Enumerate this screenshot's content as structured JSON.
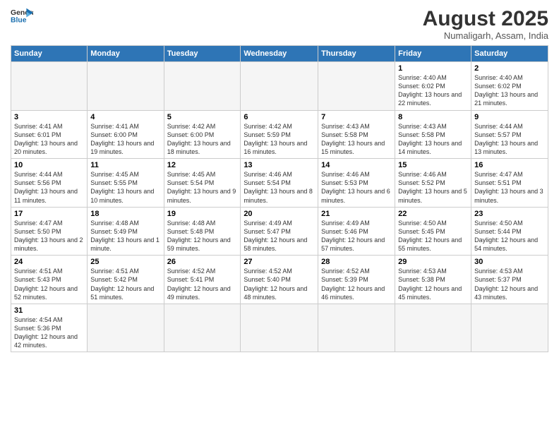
{
  "logo": {
    "text_general": "General",
    "text_blue": "Blue"
  },
  "header": {
    "month_year": "August 2025",
    "location": "Numaligarh, Assam, India"
  },
  "weekdays": [
    "Sunday",
    "Monday",
    "Tuesday",
    "Wednesday",
    "Thursday",
    "Friday",
    "Saturday"
  ],
  "weeks": [
    [
      {
        "day": "",
        "info": "",
        "empty": true
      },
      {
        "day": "",
        "info": "",
        "empty": true
      },
      {
        "day": "",
        "info": "",
        "empty": true
      },
      {
        "day": "",
        "info": "",
        "empty": true
      },
      {
        "day": "",
        "info": "",
        "empty": true
      },
      {
        "day": "1",
        "info": "Sunrise: 4:40 AM\nSunset: 6:02 PM\nDaylight: 13 hours\nand 22 minutes."
      },
      {
        "day": "2",
        "info": "Sunrise: 4:40 AM\nSunset: 6:02 PM\nDaylight: 13 hours\nand 21 minutes."
      }
    ],
    [
      {
        "day": "3",
        "info": "Sunrise: 4:41 AM\nSunset: 6:01 PM\nDaylight: 13 hours\nand 20 minutes."
      },
      {
        "day": "4",
        "info": "Sunrise: 4:41 AM\nSunset: 6:00 PM\nDaylight: 13 hours\nand 19 minutes."
      },
      {
        "day": "5",
        "info": "Sunrise: 4:42 AM\nSunset: 6:00 PM\nDaylight: 13 hours\nand 18 minutes."
      },
      {
        "day": "6",
        "info": "Sunrise: 4:42 AM\nSunset: 5:59 PM\nDaylight: 13 hours\nand 16 minutes."
      },
      {
        "day": "7",
        "info": "Sunrise: 4:43 AM\nSunset: 5:58 PM\nDaylight: 13 hours\nand 15 minutes."
      },
      {
        "day": "8",
        "info": "Sunrise: 4:43 AM\nSunset: 5:58 PM\nDaylight: 13 hours\nand 14 minutes."
      },
      {
        "day": "9",
        "info": "Sunrise: 4:44 AM\nSunset: 5:57 PM\nDaylight: 13 hours\nand 13 minutes."
      }
    ],
    [
      {
        "day": "10",
        "info": "Sunrise: 4:44 AM\nSunset: 5:56 PM\nDaylight: 13 hours\nand 11 minutes."
      },
      {
        "day": "11",
        "info": "Sunrise: 4:45 AM\nSunset: 5:55 PM\nDaylight: 13 hours\nand 10 minutes."
      },
      {
        "day": "12",
        "info": "Sunrise: 4:45 AM\nSunset: 5:54 PM\nDaylight: 13 hours\nand 9 minutes."
      },
      {
        "day": "13",
        "info": "Sunrise: 4:46 AM\nSunset: 5:54 PM\nDaylight: 13 hours\nand 8 minutes."
      },
      {
        "day": "14",
        "info": "Sunrise: 4:46 AM\nSunset: 5:53 PM\nDaylight: 13 hours\nand 6 minutes."
      },
      {
        "day": "15",
        "info": "Sunrise: 4:46 AM\nSunset: 5:52 PM\nDaylight: 13 hours\nand 5 minutes."
      },
      {
        "day": "16",
        "info": "Sunrise: 4:47 AM\nSunset: 5:51 PM\nDaylight: 13 hours\nand 3 minutes."
      }
    ],
    [
      {
        "day": "17",
        "info": "Sunrise: 4:47 AM\nSunset: 5:50 PM\nDaylight: 13 hours\nand 2 minutes."
      },
      {
        "day": "18",
        "info": "Sunrise: 4:48 AM\nSunset: 5:49 PM\nDaylight: 13 hours\nand 1 minute."
      },
      {
        "day": "19",
        "info": "Sunrise: 4:48 AM\nSunset: 5:48 PM\nDaylight: 12 hours\nand 59 minutes."
      },
      {
        "day": "20",
        "info": "Sunrise: 4:49 AM\nSunset: 5:47 PM\nDaylight: 12 hours\nand 58 minutes."
      },
      {
        "day": "21",
        "info": "Sunrise: 4:49 AM\nSunset: 5:46 PM\nDaylight: 12 hours\nand 57 minutes."
      },
      {
        "day": "22",
        "info": "Sunrise: 4:50 AM\nSunset: 5:45 PM\nDaylight: 12 hours\nand 55 minutes."
      },
      {
        "day": "23",
        "info": "Sunrise: 4:50 AM\nSunset: 5:44 PM\nDaylight: 12 hours\nand 54 minutes."
      }
    ],
    [
      {
        "day": "24",
        "info": "Sunrise: 4:51 AM\nSunset: 5:43 PM\nDaylight: 12 hours\nand 52 minutes."
      },
      {
        "day": "25",
        "info": "Sunrise: 4:51 AM\nSunset: 5:42 PM\nDaylight: 12 hours\nand 51 minutes."
      },
      {
        "day": "26",
        "info": "Sunrise: 4:52 AM\nSunset: 5:41 PM\nDaylight: 12 hours\nand 49 minutes."
      },
      {
        "day": "27",
        "info": "Sunrise: 4:52 AM\nSunset: 5:40 PM\nDaylight: 12 hours\nand 48 minutes."
      },
      {
        "day": "28",
        "info": "Sunrise: 4:52 AM\nSunset: 5:39 PM\nDaylight: 12 hours\nand 46 minutes."
      },
      {
        "day": "29",
        "info": "Sunrise: 4:53 AM\nSunset: 5:38 PM\nDaylight: 12 hours\nand 45 minutes."
      },
      {
        "day": "30",
        "info": "Sunrise: 4:53 AM\nSunset: 5:37 PM\nDaylight: 12 hours\nand 43 minutes."
      }
    ],
    [
      {
        "day": "31",
        "info": "Sunrise: 4:54 AM\nSunset: 5:36 PM\nDaylight: 12 hours\nand 42 minutes."
      },
      {
        "day": "",
        "info": "",
        "empty": true
      },
      {
        "day": "",
        "info": "",
        "empty": true
      },
      {
        "day": "",
        "info": "",
        "empty": true
      },
      {
        "day": "",
        "info": "",
        "empty": true
      },
      {
        "day": "",
        "info": "",
        "empty": true
      },
      {
        "day": "",
        "info": "",
        "empty": true
      }
    ]
  ]
}
